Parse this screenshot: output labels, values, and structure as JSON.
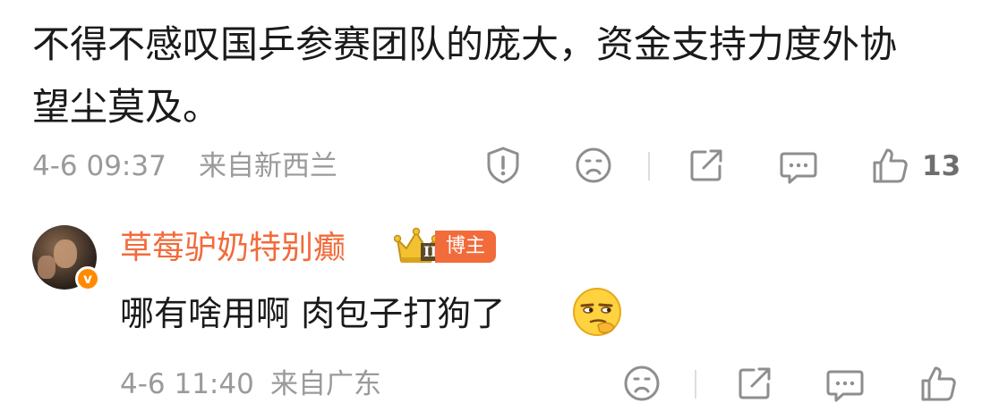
{
  "comment_main": {
    "text_line1": "不得不感叹国乒参赛团队的庞大，资金支持力度外协",
    "text_line2": "望尘莫及。",
    "date": "4-6 09:37",
    "location": "来自新西兰",
    "likes": "13"
  },
  "reply": {
    "username": "草莓驴奶特别癫",
    "badge_label": "博主",
    "crown_level": "II",
    "verified_mark": "v",
    "text": "哪有啥用啊 肉包子打狗了",
    "emoji": "smirk-emoji",
    "date": "4-6 11:40",
    "location": "来自广东"
  },
  "colors": {
    "username": "#f26b3a",
    "meta": "#9a9a9a",
    "badge_bg": "#f26b3a",
    "crown_gold": "#e8b320",
    "verified": "#ff8a00"
  },
  "icons": [
    "report-icon",
    "emoji-icon",
    "share-icon",
    "comment-icon",
    "like-icon"
  ]
}
